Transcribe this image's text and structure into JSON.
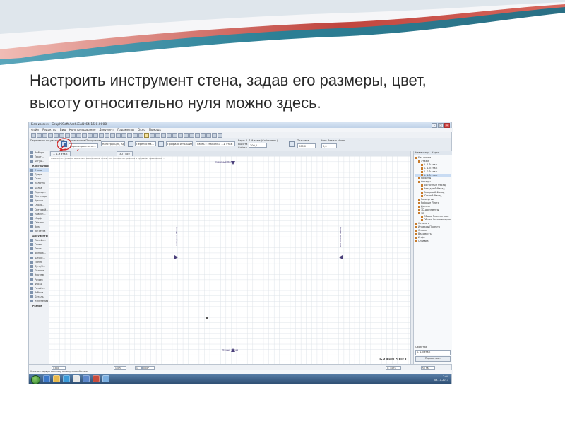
{
  "slide": {
    "heading_line1": "Настроить инструмент стена, задав его размеры, цвет,",
    "heading_line2": "высоту относительно нуля можно здесь.",
    "colors": {
      "wave_teal": "#2c7f95",
      "wave_red": "#c0453e",
      "annotation_red": "#d42424"
    }
  },
  "app": {
    "title": "Без имени - GraphiSoft ArchiCAD-64 15.0.0000",
    "menu": [
      "Файл",
      "Редактор",
      "Вид",
      "Конструирование",
      "Документ",
      "Параметры",
      "Окно",
      "Помощь"
    ],
    "infobox": {
      "params_label": "Параметры по умолчанию",
      "geometry_label": "Геометрия и Построение",
      "structure_label": "Конструкция, Ар...",
      "floor_label": "Перенос На...",
      "top_label": "Верх: 1. 1-й этаж (Собственн.)",
      "slab_label": "Собств.",
      "relation_label": "Связь с этажом 1. 1-й этаж",
      "height_label": "Высота",
      "height_value": "300,0",
      "base_label": "Низ: Этаж к Нулю",
      "offset_value": "0,0",
      "thickness_label": "Толщина",
      "thickness_value": "300,0",
      "profile_label": "Профиль и толщина",
      "settings_button_icon": "wall-settings-icon",
      "tooltip": "Параметры стены..."
    },
    "tabs": [
      "1. 1-й этаж",
      "3D / Все"
    ],
    "canvas": {
      "hint": "Начало построения: Щелкните в начальной точке. Построение и Привязка в пределах трёхмерной ...",
      "north_label": "Северный Фасад",
      "south_label": "Южный Фасад",
      "west_label": "Западный Фасад",
      "east_label": "Восточный Фасад",
      "brand": "GRAPHISOFT."
    },
    "toolbox": {
      "items": [
        {
          "label": "Выбора",
          "group": false
        },
        {
          "label": "Текст...",
          "group": false
        },
        {
          "label": "Бегущ...",
          "group": false
        },
        {
          "label": "Конструиров...",
          "group": true
        },
        {
          "label": "Стена",
          "group": false
        },
        {
          "label": "Дверь",
          "group": false
        },
        {
          "label": "Окно",
          "group": false
        },
        {
          "label": "Колонна",
          "group": false
        },
        {
          "label": "Балка",
          "group": false
        },
        {
          "label": "Перекр...",
          "group": false
        },
        {
          "label": "Лестница",
          "group": false
        },
        {
          "label": "Крыша",
          "group": false
        },
        {
          "label": "Оболо...",
          "group": false
        },
        {
          "label": "Световой...",
          "group": false
        },
        {
          "label": "Навесн...",
          "group": false
        },
        {
          "label": "Морф",
          "group": false
        },
        {
          "label": "Объект",
          "group": false
        },
        {
          "label": "Зона",
          "group": false
        },
        {
          "label": "3D сетка",
          "group": false
        },
        {
          "label": "Документы",
          "group": true
        },
        {
          "label": "Линейн...",
          "group": false
        },
        {
          "label": "Отмет...",
          "group": false
        },
        {
          "label": "Текст",
          "group": false
        },
        {
          "label": "Выноск...",
          "group": false
        },
        {
          "label": "Штрих...",
          "group": false
        },
        {
          "label": "Линия",
          "group": false
        },
        {
          "label": "Дуга/О...",
          "group": false
        },
        {
          "label": "Полили...",
          "group": false
        },
        {
          "label": "Чертеж",
          "group": false
        },
        {
          "label": "Разрез",
          "group": false
        },
        {
          "label": "Фасад",
          "group": false
        },
        {
          "label": "Развёр...",
          "group": false
        },
        {
          "label": "Рабочи...",
          "group": false
        },
        {
          "label": "Деталь",
          "group": false
        },
        {
          "label": "Изменения",
          "group": false
        },
        {
          "label": "Разное",
          "group": true
        }
      ]
    },
    "navigator": {
      "header": "Навигатор - Карта",
      "tree": [
        {
          "label": "Без имени",
          "level": 0,
          "selected": false
        },
        {
          "label": "Этажи",
          "level": 1,
          "selected": false
        },
        {
          "label": "2. 2-й этаж",
          "level": 2,
          "selected": false
        },
        {
          "label": "1. 1-й этаж",
          "level": 2,
          "selected": false
        },
        {
          "label": "0. 0-й этаж",
          "level": 2,
          "selected": false
        },
        {
          "label": "1. 1-й этаж",
          "level": 2,
          "selected": true
        },
        {
          "label": "Разрезы",
          "level": 1,
          "selected": false
        },
        {
          "label": "Фасады",
          "level": 1,
          "selected": false
        },
        {
          "label": "Восточный Фасад",
          "level": 2,
          "selected": false
        },
        {
          "label": "Западный Фасад",
          "level": 2,
          "selected": false
        },
        {
          "label": "Северный Фасад",
          "level": 2,
          "selected": false
        },
        {
          "label": "Южный Фасад",
          "level": 2,
          "selected": false
        },
        {
          "label": "Развертки",
          "level": 1,
          "selected": false
        },
        {
          "label": "Рабочие Листы",
          "level": 1,
          "selected": false
        },
        {
          "label": "Детали",
          "level": 1,
          "selected": false
        },
        {
          "label": "3D-документы",
          "level": 1,
          "selected": false
        },
        {
          "label": "3D",
          "level": 1,
          "selected": false
        },
        {
          "label": "Общая Перспектива",
          "level": 2,
          "selected": false
        },
        {
          "label": "Общая Аксонометрия",
          "level": 2,
          "selected": false
        },
        {
          "label": "Каталоги",
          "level": 0,
          "selected": false
        },
        {
          "label": "Индексы Проекта",
          "level": 0,
          "selected": false
        },
        {
          "label": "Списки",
          "level": 0,
          "selected": false
        },
        {
          "label": "Ведомость",
          "level": 0,
          "selected": false
        },
        {
          "label": "Инфо",
          "level": 0,
          "selected": false
        },
        {
          "label": "Справка",
          "level": 0,
          "selected": false
        }
      ],
      "footer_label": "Свойства",
      "footer_value": "1. 1-й этаж",
      "footer_button": "Параметры..."
    },
    "statusbar": {
      "zoom": "1:100",
      "scale": "100%",
      "page": "1",
      "angle": "0,00°",
      "disk_left": "C: 74 ГБ",
      "disk_right": "53 ГБ"
    },
    "hintbar": "Укажите первую вершину прямоугольной стены.",
    "tray_time": "2:04",
    "tray_date": "03.11.2013"
  }
}
